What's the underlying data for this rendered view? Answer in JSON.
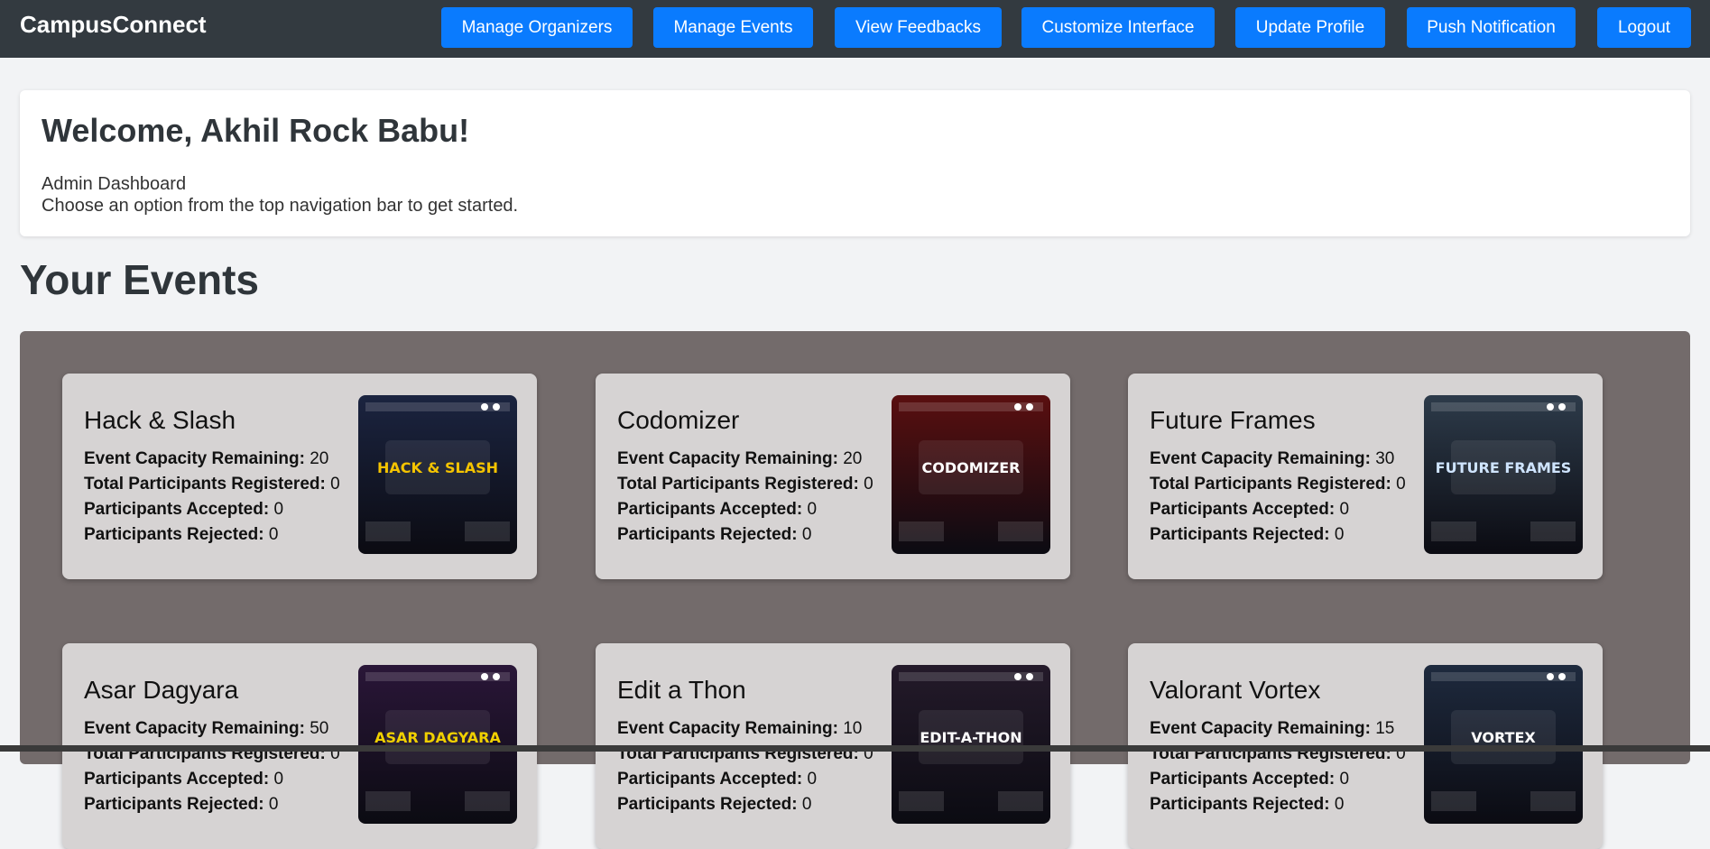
{
  "header": {
    "brand": "CampusConnect",
    "nav": [
      {
        "label": "Manage Organizers"
      },
      {
        "label": "Manage Events"
      },
      {
        "label": "View Feedbacks"
      },
      {
        "label": "Customize Interface"
      },
      {
        "label": "Update Profile"
      },
      {
        "label": "Push Notification"
      },
      {
        "label": "Logout"
      }
    ],
    "accent_color": "#0a7bfe",
    "bar_color": "#333a40"
  },
  "welcome": {
    "title": "Welcome, Akhil Rock Babu!",
    "role": "Admin Dashboard",
    "hint": "Choose an option from the top navigation bar to get started."
  },
  "events_section": {
    "title": "Your Events",
    "labels": {
      "capacity": "Event Capacity Remaining:",
      "registered": "Total Participants Registered:",
      "accepted": "Participants Accepted:",
      "rejected": "Participants Rejected:"
    },
    "events": [
      {
        "name": "Hack & Slash",
        "capacity": "20",
        "registered": "0",
        "accepted": "0",
        "rejected": "0",
        "poster": {
          "icon": "hack-slash-poster",
          "text": "HACK & SLASH",
          "bg": "#1b2440",
          "fg": "#f5c400"
        }
      },
      {
        "name": "Codomizer",
        "capacity": "20",
        "registered": "0",
        "accepted": "0",
        "rejected": "0",
        "poster": {
          "icon": "codomizer-poster",
          "text": "CODOMIZER",
          "bg": "#5a0f10",
          "fg": "#ffffff"
        }
      },
      {
        "name": "Future Frames",
        "capacity": "30",
        "registered": "0",
        "accepted": "0",
        "rejected": "0",
        "poster": {
          "icon": "future-frames-poster",
          "text": "FUTURE FRAMES",
          "bg": "#2d3b4a",
          "fg": "#cfe4ff"
        }
      },
      {
        "name": "Asar Dagyara",
        "capacity": "50",
        "registered": "0",
        "accepted": "0",
        "rejected": "0",
        "poster": {
          "icon": "asar-dagyara-poster",
          "text": "ASAR DAGYARA",
          "bg": "#2a1638",
          "fg": "#f0d000"
        }
      },
      {
        "name": "Edit a Thon",
        "capacity": "10",
        "registered": "0",
        "accepted": "0",
        "rejected": "0",
        "poster": {
          "icon": "edit-a-thon-poster",
          "text": "EDIT-A-THON",
          "bg": "#241a2a",
          "fg": "#ffffff"
        }
      },
      {
        "name": "Valorant Vortex",
        "capacity": "15",
        "registered": "0",
        "accepted": "0",
        "rejected": "0",
        "poster": {
          "icon": "valorant-vortex-poster",
          "text": "VORTEX",
          "bg": "#1e2a3e",
          "fg": "#ffffff"
        }
      }
    ]
  }
}
